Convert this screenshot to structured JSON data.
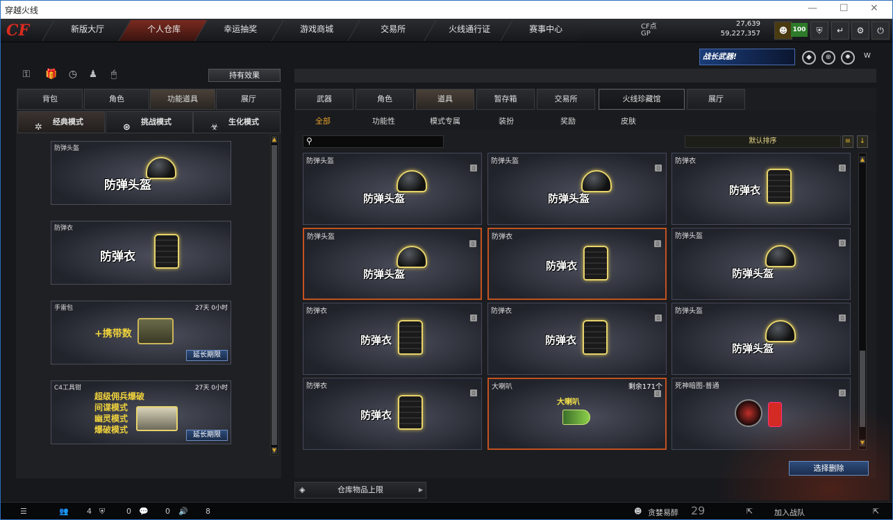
{
  "window": {
    "title": "穿越火线"
  },
  "nav": {
    "logo": "CF",
    "tabs": [
      "新版大厅",
      "个人仓库",
      "幸运抽奖",
      "游戏商城",
      "交易所",
      "火线通行证",
      "赛事中心"
    ],
    "active": "个人仓库"
  },
  "stats": {
    "cf_label": "CF点",
    "cf_value": "27,639",
    "gp_label": "GP",
    "gp_value": "59,227,357",
    "level": "100"
  },
  "banner": {
    "text": "战长武器!"
  },
  "left": {
    "hold_effect": "持有效果",
    "tabs": [
      "背包",
      "角色",
      "功能道具",
      "展厅"
    ],
    "active_tab": "功能道具",
    "modes": [
      "经典模式",
      "挑战模式",
      "生化模式"
    ],
    "active_mode": "经典模式",
    "items": [
      {
        "name": "防弹头盔",
        "big": "防弹头盔",
        "time": "",
        "extend": ""
      },
      {
        "name": "防弹衣",
        "big": "防弹衣",
        "time": "",
        "extend": ""
      },
      {
        "name": "手雷包",
        "big": "+携带数",
        "time": "27天 0小时",
        "extend": "延长期限"
      },
      {
        "name": "C4工具钳",
        "big": "",
        "lines": [
          "超级佣兵爆破",
          "间谍模式",
          "幽灵模式",
          "爆破模式"
        ],
        "time": "27天 0小时",
        "extend": "延长期限"
      }
    ]
  },
  "right": {
    "tabs": [
      "武器",
      "角色",
      "道具",
      "暂存箱",
      "交易所",
      "火线珍藏馆",
      "展厅"
    ],
    "active_tab": "道具",
    "subtabs": [
      "全部",
      "功能性",
      "模式专属",
      "装扮",
      "奖励",
      "皮肤"
    ],
    "active_subtab": "全部",
    "search_placeholder": "",
    "sort_label": "默认排序",
    "items": [
      {
        "name": "防弹头盔",
        "big": "防弹头盔",
        "kind": "helmet"
      },
      {
        "name": "防弹头盔",
        "big": "防弹头盔",
        "kind": "helmet"
      },
      {
        "name": "防弹衣",
        "big": "防弹衣",
        "kind": "vest"
      },
      {
        "name": "防弹头盔",
        "big": "防弹头盔",
        "kind": "helmet"
      },
      {
        "name": "防弹衣",
        "big": "防弹衣",
        "kind": "vest"
      },
      {
        "name": "防弹头盔",
        "big": "防弹头盔",
        "kind": "helmet"
      },
      {
        "name": "防弹衣",
        "big": "防弹衣",
        "kind": "vest"
      },
      {
        "name": "防弹衣",
        "big": "防弹衣",
        "kind": "vest"
      },
      {
        "name": "防弹头盔",
        "big": "防弹头盔",
        "kind": "helmet"
      },
      {
        "name": "防弹衣",
        "big": "防弹衣",
        "kind": "vest"
      },
      {
        "name": "大喇叭",
        "big": "大喇叭",
        "kind": "horn",
        "remain": "剩余171个"
      },
      {
        "name": "死神暗图-普通",
        "big": "",
        "kind": "ghost"
      }
    ],
    "delete_button": "选择删除",
    "limit_label": "仓库物品上限"
  },
  "statusbar": {
    "friends": "4",
    "shield": "0",
    "chat": "0",
    "volume": "8",
    "mode": "贪婪易醉",
    "level": "29",
    "join": "加入战队"
  }
}
